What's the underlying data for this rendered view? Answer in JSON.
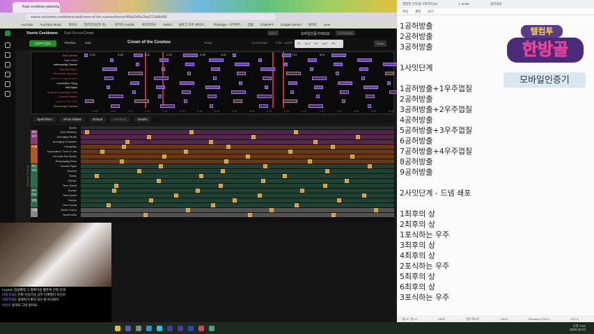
{
  "browser": {
    "tab_title": "Raid cooldown planning tool",
    "url": "viserio.ch/viserio-cooldowns/raid/crown-of-the-cosmos/heroic/4f6fa2bf5b26a0213b8b960",
    "bookmarks": [
      "YouTube",
      "YouTube Music",
      "파이어",
      "밀리언과공주 화...",
      "관리자 CHZZK",
      "마이리저브",
      "Twitch",
      "블로그 하프 세이브...",
      "Thorlinge - 나무위키",
      "겜플",
      "ChatGPT",
      "Google Gemini",
      "원카트",
      "wow"
    ]
  },
  "app": {
    "name": "Viserio Cooldowns",
    "nav": [
      "Raid Reruns",
      "Crown"
    ],
    "user": "모바일인증기#5633",
    "community": "Community",
    "copy_label": "COPY CDs",
    "timeline_tab": "Timeline",
    "grid_tab": "Grid",
    "boss_title": "Crown of the Cosmos",
    "setup_label": "Setup",
    "connected": "Connected",
    "time_range": "0:00 - 10:00",
    "phases": [
      "P1",
      "Int 1",
      "P2",
      "Int 2",
      "P3"
    ],
    "reset_label": "Reset",
    "search_shortcut": "Ctrl K"
  },
  "boss_abilities": [
    "Null Corona",
    "Dark Hand",
    "Interrupting Tremor",
    "Void Expulsion",
    "Silverstrike Barrage",
    "Unbound Catastrophe",
    "Voidstalker Sting",
    "Rift Slash",
    "Singular Cataclysm Void",
    "Cosmic Barrier",
    "Impact of the Star",
    "Devouring Cosmos"
  ],
  "boss_timestamps": [
    "0:04",
    "0:48",
    "1:28",
    "2:23",
    "2:58",
    "3:40",
    "7:07",
    "8:07"
  ],
  "time_ticks": [
    "0:30",
    "1:00",
    "1:30",
    "2:00",
    "2:30",
    "3:00",
    "3:30",
    "4:00",
    "4:30",
    "5:00",
    "5:30",
    "6:00",
    "6:30",
    "7:00",
    "7:30",
    "8:00",
    "8:30",
    "9:00"
  ],
  "filters": {
    "spell_filters": "Spell filters",
    "show_hidden": "Show hidden",
    "default": "Default",
    "heatmap": "Heatmap",
    "deaths": "Deaths"
  },
  "timeline_caption": "Timeline Controls",
  "player_groups": [
    {
      "name": "세러 일리",
      "color": "#8a3a7a",
      "spells": [
        "Aura Mastery",
        "Avenging Wrath",
        "Avenging Crusader"
      ]
    },
    {
      "name": "드넴",
      "color": "#b05a1a",
      "spells": [
        "Tranquility",
        "Incarnation: Tree of Life",
        "Convoke the Spirits",
        "Rampaging Roar"
      ]
    },
    {
      "name": "특산 하리",
      "color": "#2a6a50",
      "spells": [
        "Dream Flight",
        "Rewind",
        "Stasis",
        "Zephyr",
        "Time Spiral"
      ]
    },
    {
      "name": "전트 린유",
      "color": "#2a6a50",
      "spells": [
        "Zephyr",
        "Time Spiral"
      ]
    },
    {
      "name": "말들",
      "color": "#2a6a50",
      "spells": [
        "Zephyr",
        "Time Spiral"
      ]
    },
    {
      "name": "사제",
      "color": "#888",
      "spells": [
        "Divine Hymn",
        "Apotheosis"
      ]
    }
  ],
  "notes_label": "Notes",
  "chat": [
    {
      "user": "Kaydoh",
      "msg": "점갈팬데 그 명확이랑 팰픈톡 안찍 던데"
    },
    {
      "user": "마정가대응",
      "msg": "진짜 인증기님 공부 진짜많이 하신다"
    },
    {
      "user": "마정가대응",
      "msg": "실제자가 판의 되는게 아니였어"
    },
    {
      "user": "바상호",
      "msg": "갈려요 그냥 갈아요"
    }
  ],
  "notepad": {
    "tabs": [
      "결정전 신유림 나락지리.txt",
      "1 .txnter",
      "넘치방증"
    ],
    "menu": [
      "파일",
      "편집",
      "보기"
    ],
    "lines": [
      "1공허방출",
      "2공허방출",
      "3공허방출",
      "",
      "1사잇단계",
      "",
      "1공허방출+1우주껍질",
      "2공허방출",
      "3공허방출+2우주껍질",
      "4공허방출",
      "5공허방출+3우주껍질",
      "6공허방출",
      "7공허방출+4우주껍질",
      "8공허방출",
      "9공허방출",
      "",
      "2사잇단계 - 드넴 쇄포",
      "",
      "1최후의 상",
      "2최후의 상",
      "1포식하는 우주",
      "3최후의 상",
      "4최후의 상",
      "2포식하는 우주",
      "5최후의 상",
      "6최후의 상",
      "3포식하는 우주"
    ],
    "status": [
      "줄 37, 열 12",
      "196자",
      "일반 텍스트",
      "100%",
      "Windows (CRLF)",
      "UTF-8"
    ]
  },
  "logo": {
    "line1": "텔컴투",
    "line2": "한방골",
    "badge": "모바일인증기"
  },
  "clock": {
    "time": "오후 3:41",
    "date": "2026-03-22"
  }
}
